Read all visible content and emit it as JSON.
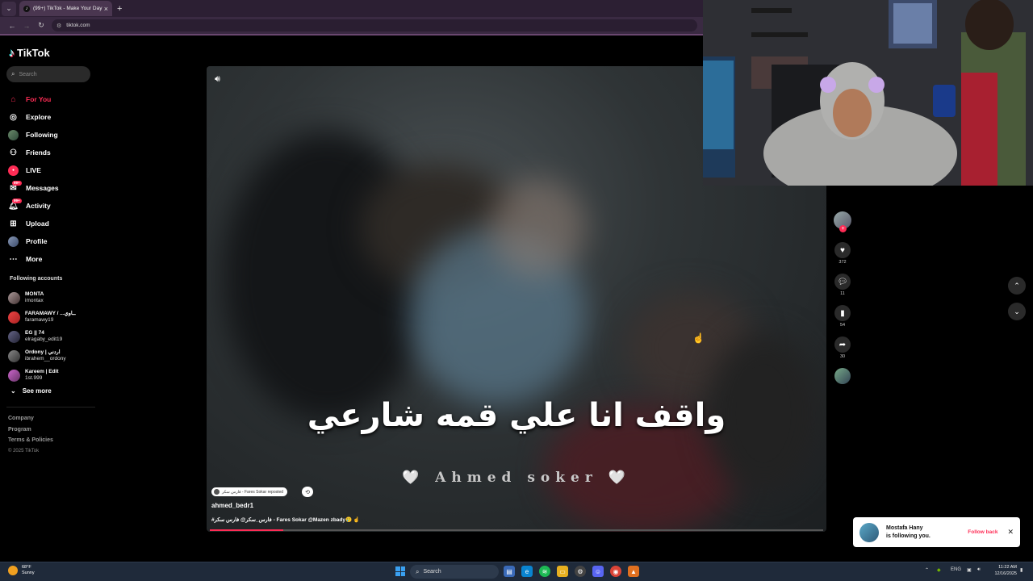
{
  "browser": {
    "tab_title": "(99+) TikTok - Make Your Day",
    "url": "tiktok.com"
  },
  "sidebar": {
    "logo_text": "TikTok",
    "search_placeholder": "Search",
    "nav": [
      {
        "label": "For You",
        "icon": "home-icon"
      },
      {
        "label": "Explore",
        "icon": "compass-icon"
      },
      {
        "label": "Following",
        "icon": "avatar-icon"
      },
      {
        "label": "Friends",
        "icon": "friends-icon"
      },
      {
        "label": "LIVE",
        "icon": "live-icon"
      },
      {
        "label": "Messages",
        "icon": "message-icon",
        "badge": "99+"
      },
      {
        "label": "Activity",
        "icon": "bell-icon",
        "badge": "99+"
      },
      {
        "label": "Upload",
        "icon": "plus-square-icon"
      },
      {
        "label": "Profile",
        "icon": "profile-icon"
      },
      {
        "label": "More",
        "icon": "more-icon"
      }
    ],
    "following_heading": "Following accounts",
    "accounts": [
      {
        "name": "MONTA",
        "user": "imontax"
      },
      {
        "name": "FARAMAWY / ...ــاوي",
        "user": "faramawy19"
      },
      {
        "name": "EG || 74",
        "user": "elragaby_edit19"
      },
      {
        "name": "Ordony | اردني",
        "user": "ibrahem__ordony"
      },
      {
        "name": "Kareem | Edit",
        "user": "1st.999"
      }
    ],
    "see_more": "See more",
    "footer": [
      "Company",
      "Program",
      "Terms & Policies"
    ],
    "copyright": "© 2025 TikTok"
  },
  "video": {
    "caption_arabic": "واقف انا علي قمه شارعي",
    "signature": "🤍 Ahmed soker 🤍",
    "repost_chip": "فارس سكر - Fares Sokar reposted",
    "author": "ahmed_bedr1",
    "description": "#فارس_سكر@ فارس سكر - Fares Sokar @Mazen zbady🥲 ☝",
    "progress_fraction": 0.12
  },
  "actions": {
    "likes": "372",
    "comments": "11",
    "saves": "54",
    "shares": "30"
  },
  "notification": {
    "name": "Mostafa Hany",
    "text": "is following you.",
    "follow_back": "Follow back"
  },
  "taskbar": {
    "temp": "68°F",
    "weather": "Sunny",
    "search": "Search",
    "lang": "ENG",
    "time": "11:22 AM",
    "date": "12/16/2025"
  },
  "colors": {
    "accent": "#fe2c55",
    "chrome": "#2c1f33"
  }
}
